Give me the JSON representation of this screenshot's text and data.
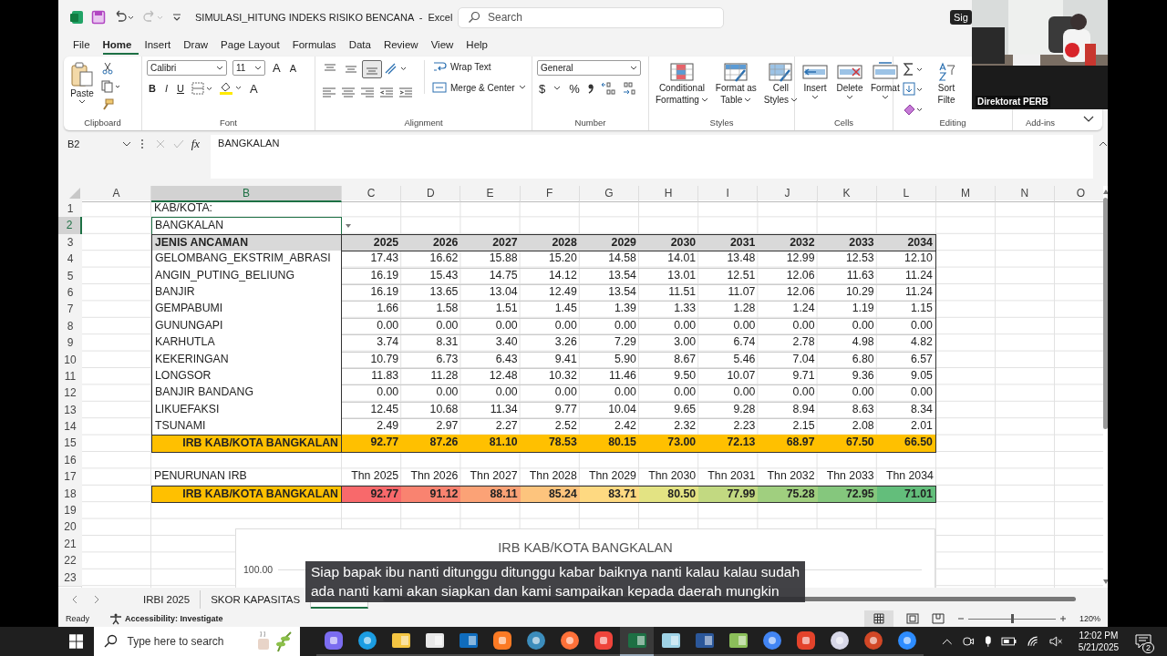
{
  "window": {
    "title": "SIMULASI_HITUNG INDEKS RISIKO BENCANA  -  Excel",
    "search_placeholder": "Search",
    "account": "Sig"
  },
  "menu_tabs": [
    {
      "label": "File",
      "selected": false
    },
    {
      "label": "Home",
      "selected": true
    },
    {
      "label": "Insert",
      "selected": false
    },
    {
      "label": "Draw",
      "selected": false
    },
    {
      "label": "Page Layout",
      "selected": false
    },
    {
      "label": "Formulas",
      "selected": false
    },
    {
      "label": "Data",
      "selected": false
    },
    {
      "label": "Review",
      "selected": false
    },
    {
      "label": "View",
      "selected": false
    },
    {
      "label": "Help",
      "selected": false
    }
  ],
  "ribbon": {
    "clipboard": {
      "paste": "Paste",
      "label": "Clipboard"
    },
    "font": {
      "name": "Calibri",
      "size": "11",
      "grow": "A",
      "shrink": "A",
      "styles": [
        "B",
        "I",
        "U"
      ],
      "text_color_button": "A",
      "label": "Font"
    },
    "alignment": {
      "vertical": [
        {
          "selected": false
        },
        {
          "selected": false
        },
        {
          "selected": true
        }
      ],
      "wrap": "Wrap Text",
      "merge": "Merge & Center",
      "label": "Alignment"
    },
    "number": {
      "format": "General",
      "currency": "$",
      "percent": "%",
      "label": "Number"
    },
    "styles": {
      "buttons": [
        {
          "kind": "conditional",
          "lines": [
            "Conditional",
            "Formatting"
          ]
        },
        {
          "kind": "table",
          "lines": [
            "Format as",
            "Table"
          ]
        },
        {
          "kind": "cellstyles",
          "lines": [
            "Cell",
            "Styles"
          ]
        }
      ],
      "label": "Styles"
    },
    "cells": {
      "buttons": [
        {
          "kind": "insert",
          "label": "Insert"
        },
        {
          "kind": "delete",
          "label": "Delete"
        },
        {
          "kind": "format",
          "label": "Format"
        }
      ],
      "label": "Cells"
    },
    "editing": {
      "sort": [
        "Sort",
        "Filte"
      ],
      "label": "Editing"
    },
    "addins": {
      "label": "Add-ins"
    }
  },
  "formula_bar": {
    "name_box": "B2",
    "fx": "fx",
    "value": "BANGKALAN"
  },
  "columns": [
    {
      "label": "A",
      "selected": false
    },
    {
      "label": "B",
      "selected": true
    },
    {
      "label": "C",
      "selected": false
    },
    {
      "label": "D",
      "selected": false
    },
    {
      "label": "E",
      "selected": false
    },
    {
      "label": "F",
      "selected": false
    },
    {
      "label": "G",
      "selected": false
    },
    {
      "label": "H",
      "selected": false
    },
    {
      "label": "I",
      "selected": false
    },
    {
      "label": "J",
      "selected": false
    },
    {
      "label": "K",
      "selected": false
    },
    {
      "label": "L",
      "selected": false
    },
    {
      "label": "M",
      "selected": false
    },
    {
      "label": "N",
      "selected": false
    },
    {
      "label": "O",
      "selected": false
    }
  ],
  "rows": [
    {
      "num": "1",
      "kind": "text",
      "selected": false,
      "label": "KAB/KOTA:"
    },
    {
      "num": "2",
      "kind": "input",
      "selected": true,
      "label": "BANGKALAN"
    },
    {
      "num": "3",
      "kind": "header",
      "selected": false,
      "label": "JENIS ANCAMAN",
      "values": [
        "2025",
        "2026",
        "2027",
        "2028",
        "2029",
        "2030",
        "2031",
        "2032",
        "2033",
        "2034"
      ]
    },
    {
      "num": "4",
      "kind": "data",
      "selected": false,
      "label": "GELOMBANG_EKSTRIM_ABRASI",
      "values": [
        "17.43",
        "16.62",
        "15.88",
        "15.20",
        "14.58",
        "14.01",
        "13.48",
        "12.99",
        "12.53",
        "12.10"
      ]
    },
    {
      "num": "5",
      "kind": "data",
      "selected": false,
      "label": "ANGIN_PUTING_BELIUNG",
      "values": [
        "16.19",
        "15.43",
        "14.75",
        "14.12",
        "13.54",
        "13.01",
        "12.51",
        "12.06",
        "11.63",
        "11.24"
      ]
    },
    {
      "num": "6",
      "kind": "data",
      "selected": false,
      "label": "BANJIR",
      "values": [
        "16.19",
        "13.65",
        "13.04",
        "12.49",
        "13.54",
        "11.51",
        "11.07",
        "12.06",
        "10.29",
        "11.24"
      ]
    },
    {
      "num": "7",
      "kind": "data",
      "selected": false,
      "label": "GEMPABUMI",
      "values": [
        "1.66",
        "1.58",
        "1.51",
        "1.45",
        "1.39",
        "1.33",
        "1.28",
        "1.24",
        "1.19",
        "1.15"
      ]
    },
    {
      "num": "8",
      "kind": "data",
      "selected": false,
      "label": "GUNUNGAPI",
      "values": [
        "0.00",
        "0.00",
        "0.00",
        "0.00",
        "0.00",
        "0.00",
        "0.00",
        "0.00",
        "0.00",
        "0.00"
      ]
    },
    {
      "num": "9",
      "kind": "data",
      "selected": false,
      "label": "KARHUTLA",
      "values": [
        "3.74",
        "8.31",
        "3.40",
        "3.26",
        "7.29",
        "3.00",
        "6.74",
        "2.78",
        "4.98",
        "4.82"
      ]
    },
    {
      "num": "10",
      "kind": "data",
      "selected": false,
      "label": "KEKERINGAN",
      "values": [
        "10.79",
        "6.73",
        "6.43",
        "9.41",
        "5.90",
        "8.67",
        "5.46",
        "7.04",
        "6.80",
        "6.57"
      ]
    },
    {
      "num": "11",
      "kind": "data",
      "selected": false,
      "label": "LONGSOR",
      "values": [
        "11.83",
        "11.28",
        "12.48",
        "10.32",
        "11.46",
        "9.50",
        "10.07",
        "9.71",
        "9.36",
        "9.05"
      ]
    },
    {
      "num": "12",
      "kind": "data",
      "selected": false,
      "label": "BANJIR BANDANG",
      "values": [
        "0.00",
        "0.00",
        "0.00",
        "0.00",
        "0.00",
        "0.00",
        "0.00",
        "0.00",
        "0.00",
        "0.00"
      ]
    },
    {
      "num": "13",
      "kind": "data",
      "selected": false,
      "label": "LIKUEFAKSI",
      "values": [
        "12.45",
        "10.68",
        "11.34",
        "9.77",
        "10.04",
        "9.65",
        "9.28",
        "8.94",
        "8.63",
        "8.34"
      ]
    },
    {
      "num": "14",
      "kind": "data",
      "selected": false,
      "label": "TSUNAMI",
      "values": [
        "2.49",
        "2.97",
        "2.27",
        "2.52",
        "2.42",
        "2.32",
        "2.23",
        "2.15",
        "2.08",
        "2.01"
      ]
    },
    {
      "num": "15",
      "kind": "total",
      "selected": false,
      "label": "IRB KAB/KOTA BANGKALAN",
      "values": [
        "92.77",
        "87.26",
        "81.10",
        "78.53",
        "80.15",
        "73.00",
        "72.13",
        "68.97",
        "67.50",
        "66.50"
      ]
    },
    {
      "num": "16",
      "kind": "blank",
      "selected": false
    },
    {
      "num": "17",
      "kind": "text",
      "selected": false,
      "label": "PENURUNAN IRB",
      "values": [
        "Thn 2025",
        "Thn 2026",
        "Thn 2027",
        "Thn 2028",
        "Thn 2029",
        "Thn 2030",
        "Thn 2031",
        "Thn 2032",
        "Thn 2033",
        "Thn 2034"
      ]
    },
    {
      "num": "18",
      "kind": "heat",
      "selected": false,
      "label": "IRB KAB/KOTA BANGKALAN",
      "values": [
        {
          "text": "92.77",
          "color": "#f8696b"
        },
        {
          "text": "91.12",
          "color": "#f98370"
        },
        {
          "text": "88.11",
          "color": "#fba276"
        },
        {
          "text": "85.24",
          "color": "#fdc47d"
        },
        {
          "text": "83.71",
          "color": "#fed981"
        },
        {
          "text": "80.50",
          "color": "#e3e383"
        },
        {
          "text": "77.99",
          "color": "#c2d981"
        },
        {
          "text": "75.28",
          "color": "#a0cf7f"
        },
        {
          "text": "72.95",
          "color": "#85c77d"
        },
        {
          "text": "71.01",
          "color": "#63be7b"
        }
      ]
    },
    {
      "num": "19",
      "kind": "blank",
      "selected": false
    },
    {
      "num": "20",
      "kind": "blank",
      "selected": false
    },
    {
      "num": "21",
      "kind": "blank",
      "selected": false
    },
    {
      "num": "22",
      "kind": "blank",
      "selected": false
    },
    {
      "num": "23",
      "kind": "blank",
      "selected": false
    }
  ],
  "chart": {
    "title": "IRB KAB/KOTA BANGKALAN",
    "tick": "100.00"
  },
  "sheet_tabs": [
    {
      "label": "IRBI 2025",
      "selected": false
    },
    {
      "label": "SKOR KAPASITAS",
      "selected": false
    },
    {
      "selected": true
    }
  ],
  "status_bar": {
    "ready": "Ready",
    "accessibility": "Accessibility: Investigate",
    "zoom": "120%",
    "level": 0.5
  },
  "video": {
    "name": "Direktorat PERB"
  },
  "subtitle": {
    "lines": [
      "Siap bapak ibu nanti ditunggu ditunggu kabar baiknya nanti kalau kalau sudah",
      "ada nanti kami akan siapkan dan kami sampaikan kepada daerah mungkin"
    ]
  },
  "taskbar": {
    "search_placeholder": "Type here to search",
    "apps": [
      {
        "kind": "copilot",
        "selected": false
      },
      {
        "kind": "edge",
        "selected": false
      },
      {
        "kind": "folder",
        "selected": false
      },
      {
        "kind": "store",
        "selected": false
      },
      {
        "kind": "outlook",
        "selected": false
      },
      {
        "kind": "xampp",
        "selected": false
      },
      {
        "kind": "globe",
        "selected": false
      },
      {
        "kind": "firefox",
        "selected": false
      },
      {
        "kind": "anydesk",
        "selected": false
      },
      {
        "kind": "excel",
        "selected": true
      },
      {
        "kind": "notepad",
        "selected": false
      },
      {
        "kind": "word",
        "selected": false
      },
      {
        "kind": "chart",
        "selected": false
      },
      {
        "kind": "chrome",
        "selected": false
      },
      {
        "kind": "acrobat",
        "selected": false
      },
      {
        "kind": "snip",
        "selected": false
      },
      {
        "kind": "powerpoint",
        "selected": false
      },
      {
        "kind": "zoom",
        "selected": false
      }
    ],
    "time": "12:02 PM",
    "date": "5/21/2025",
    "notifications": "2"
  }
}
